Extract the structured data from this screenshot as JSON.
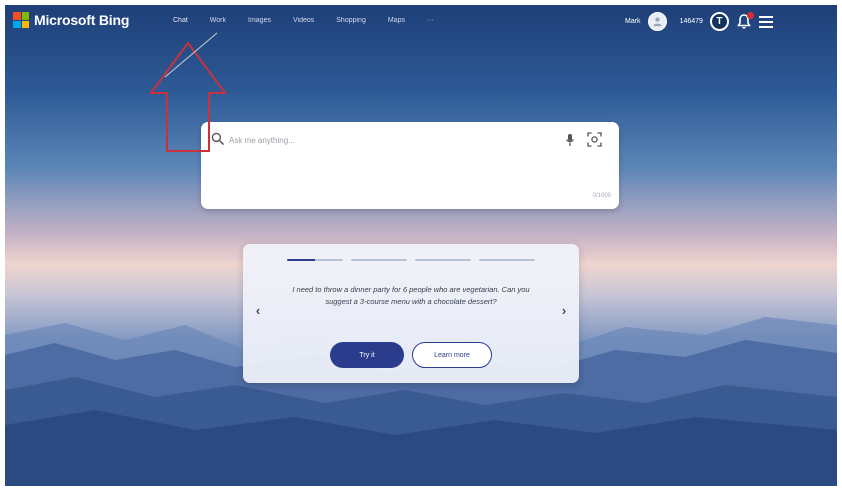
{
  "brand": {
    "name": "Microsoft Bing"
  },
  "nav": {
    "items": [
      {
        "label": "Chat"
      },
      {
        "label": "Work"
      },
      {
        "label": "Images"
      },
      {
        "label": "Videos"
      },
      {
        "label": "Shopping"
      },
      {
        "label": "Maps"
      },
      {
        "label": "···"
      }
    ]
  },
  "user": {
    "name": "Mark",
    "points": "146479",
    "reward_glyph": "T"
  },
  "search": {
    "placeholder": "Ask me anything...",
    "char_count": "0/1000"
  },
  "prompt_card": {
    "text": "I need to throw a dinner party for 6 people who are vegetarian. Can you suggest a 3-course menu with a chocolate dessert?",
    "try_label": "Try it",
    "learn_label": "Learn more",
    "prev_glyph": "‹",
    "next_glyph": "›",
    "slides_total": 4,
    "active_slide": 1
  },
  "colors": {
    "accent": "#2c3c8d",
    "annotation": "#c8323c",
    "logo": [
      "#f25022",
      "#7fba00",
      "#00a4ef",
      "#ffb900"
    ]
  },
  "icons": [
    "search-icon",
    "mic-icon",
    "visual-search-icon",
    "avatar-icon",
    "rewards-icon",
    "notification-bell-icon",
    "hamburger-menu-icon",
    "annotation-arrow-icon"
  ]
}
